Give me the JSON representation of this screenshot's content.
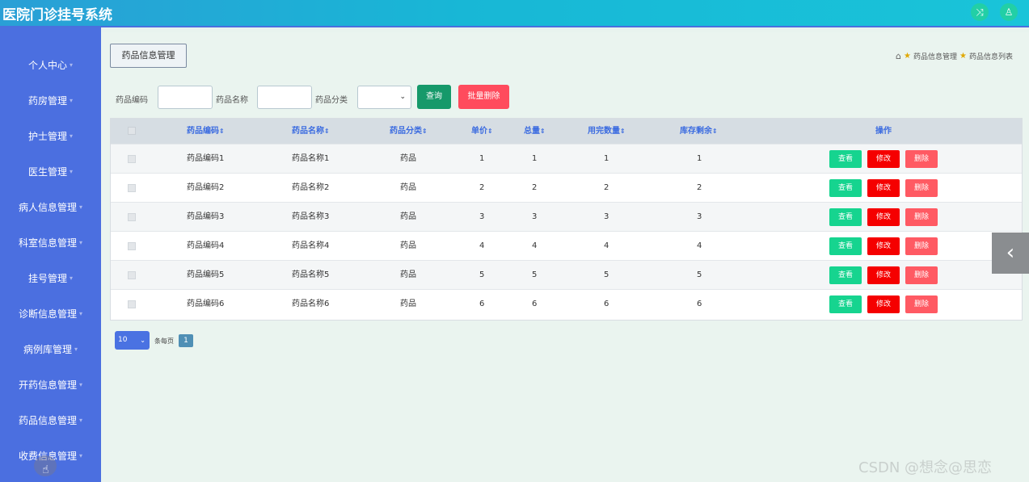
{
  "app": {
    "title": "医院门诊挂号系统"
  },
  "topbar": {
    "icons": [
      "shuffle-icon",
      "user-icon"
    ],
    "glyphs": [
      "⤨",
      "♙"
    ]
  },
  "sidebar": {
    "caret": "▾",
    "items": [
      {
        "label": "个人中心"
      },
      {
        "label": "药房管理"
      },
      {
        "label": "护士管理"
      },
      {
        "label": "医生管理"
      },
      {
        "label": "病人信息管理"
      },
      {
        "label": "科室信息管理"
      },
      {
        "label": "挂号管理"
      },
      {
        "label": "诊断信息管理"
      },
      {
        "label": "病例库管理"
      },
      {
        "label": "开药信息管理"
      },
      {
        "label": "药品信息管理"
      },
      {
        "label": "收费信息管理"
      }
    ]
  },
  "main": {
    "page_button": "药品信息管理",
    "breadcrumb": {
      "home_glyph": "⌂",
      "star_glyph": "★",
      "items": [
        "药品信息管理",
        "药品信息列表"
      ]
    },
    "search": {
      "code_label": "药品编码",
      "code_value": "",
      "name_label": "药品名称",
      "name_value": "",
      "category_label": "药品分类",
      "category_value": "",
      "chevron": "⌄",
      "query_button": "查询",
      "batch_delete_button": "批量删除"
    },
    "table": {
      "sort_glyph": "⇕",
      "headers": [
        "药品编码",
        "药品名称",
        "药品分类",
        "单价",
        "总量",
        "用完数量",
        "库存剩余",
        "操作"
      ],
      "rows": [
        {
          "code": "药品编码1",
          "name": "药品名称1",
          "category": "药品",
          "price": "1",
          "total": "1",
          "used": "1",
          "remaining": "1"
        },
        {
          "code": "药品编码2",
          "name": "药品名称2",
          "category": "药品",
          "price": "2",
          "total": "2",
          "used": "2",
          "remaining": "2"
        },
        {
          "code": "药品编码3",
          "name": "药品名称3",
          "category": "药品",
          "price": "3",
          "total": "3",
          "used": "3",
          "remaining": "3"
        },
        {
          "code": "药品编码4",
          "name": "药品名称4",
          "category": "药品",
          "price": "4",
          "total": "4",
          "used": "4",
          "remaining": "4"
        },
        {
          "code": "药品编码5",
          "name": "药品名称5",
          "category": "药品",
          "price": "5",
          "total": "5",
          "used": "5",
          "remaining": "5"
        },
        {
          "code": "药品编码6",
          "name": "药品名称6",
          "category": "药品",
          "price": "6",
          "total": "6",
          "used": "6",
          "remaining": "6"
        }
      ],
      "actions": {
        "view": "查看",
        "edit": "修改",
        "delete": "删除"
      }
    },
    "pagination": {
      "page_size": "10",
      "chevron": "⌄",
      "per_page_label": "条每页",
      "current_page": "1"
    }
  },
  "side_toggle": {
    "glyph": "‹"
  },
  "watermark": "CSDN @想念@思恋",
  "colors": {
    "sidebar": "#4b6fe0",
    "view": "#16d48f",
    "edit": "#f50000",
    "delete": "#ff5a63",
    "query": "#16996a",
    "batch_delete": "#ff4b5d"
  }
}
